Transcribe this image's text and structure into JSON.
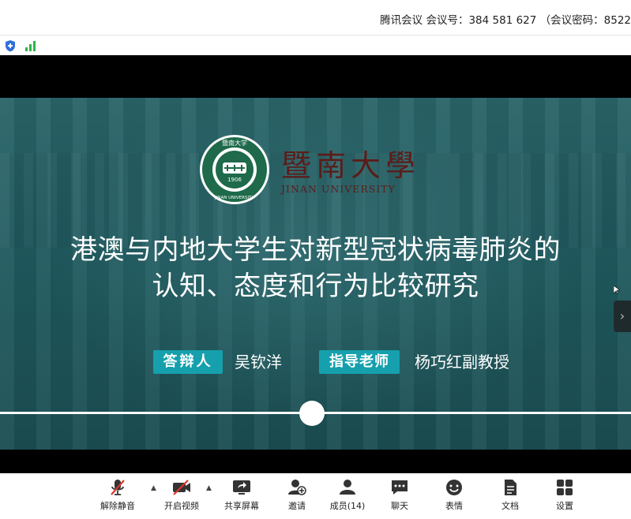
{
  "titlebar": {
    "meeting_info": "腾讯会议  会议号：384 581 627 （会议密码：8522"
  },
  "slide": {
    "logo_cn": "暨南大學",
    "logo_en": "JINAN UNIVERSITY",
    "seal_top": "暨南大学",
    "seal_year": "1906",
    "seal_bottom": "JINAN UNIVERSITY",
    "title_line1": "港澳与内地大学生对新型冠状病毒肺炎的",
    "title_line2": "认知、态度和行为比较研究",
    "defender_tag": "答辩人",
    "defender_name": "吴钦洋",
    "advisor_tag": "指导老师",
    "advisor_name": "杨巧红副教授",
    "progress": 0.494
  },
  "toolbar": {
    "unmute": "解除静音",
    "start_video": "开启视频",
    "share_screen": "共享屏幕",
    "invite": "邀请",
    "members": "成员(14)",
    "chat": "聊天",
    "reactions": "表情",
    "docs": "文档",
    "settings": "设置"
  },
  "icons": {
    "shield": "shield-icon",
    "signal": "signal-icon",
    "mic": "mic-off-icon",
    "camera": "camera-off-icon",
    "share": "share-screen-icon",
    "invite": "add-user-icon",
    "members": "members-icon",
    "chat": "chat-icon",
    "emoji": "emoji-icon",
    "doc": "document-icon",
    "settings": "grid-settings-icon"
  },
  "colors": {
    "accent": "#16a0ad",
    "slide_bg": "#1f5a5f",
    "logo": "#5a1d1a",
    "mute_red": "#e0342b"
  }
}
